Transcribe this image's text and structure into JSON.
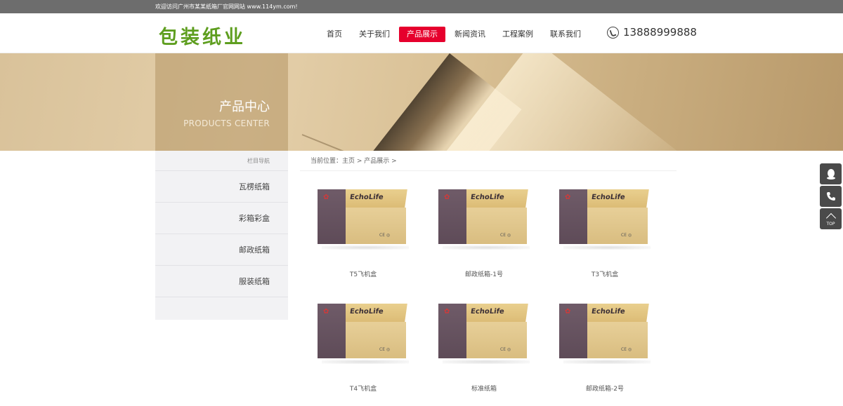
{
  "topbar": {
    "welcome": "欢迎访问广州市某某纸箱厂官网网站 www.114ym.com!"
  },
  "header": {
    "logo": "包装纸业",
    "nav": [
      "首页",
      "关于我们",
      "产品展示",
      "新闻资讯",
      "工程案例",
      "联系我们"
    ],
    "active_nav": "产品展示",
    "phone": "13888999888"
  },
  "banner": {
    "title_cn": "产品中心",
    "title_en": "PRODUCTS CENTER"
  },
  "sidebar": {
    "title": "栏目导航",
    "items": [
      "瓦楞纸箱",
      "彩箱彩盒",
      "邮政纸箱",
      "服装纸箱"
    ]
  },
  "breadcrumb": {
    "text": "当前位置：主页 > 产品展示 >"
  },
  "products": [
    {
      "name": "T5飞机盒",
      "brand": "EchoLife"
    },
    {
      "name": "邮政纸箱-1号",
      "brand": "EchoLife"
    },
    {
      "name": "T3飞机盒",
      "brand": "EchoLife"
    },
    {
      "name": "T4飞机盒",
      "brand": "EchoLife"
    },
    {
      "name": "标准纸箱",
      "brand": "EchoLife"
    },
    {
      "name": "邮政纸箱-2号",
      "brand": "EchoLife"
    }
  ],
  "float_bar": {
    "top_label": "TOP",
    "icons": [
      "qq-icon",
      "phone-icon",
      "back-to-top-icon"
    ]
  },
  "colors": {
    "accent": "#e6002d",
    "logo": "#5e9e1f",
    "topbar": "#6d6d6d"
  }
}
